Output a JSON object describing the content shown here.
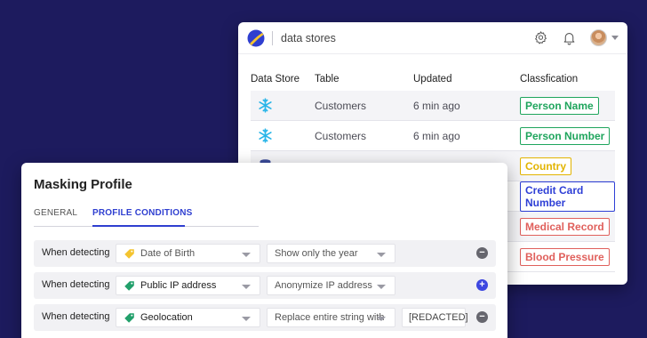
{
  "colors": {
    "background": "#1d1b5e",
    "accent_blue": "#2f3fd0",
    "snowflake": "#29b5e8",
    "tag_yellow": "#f4c430",
    "tag_green": "#22a06b"
  },
  "data_stores": {
    "title": "data stores",
    "icons": [
      "logo-icon",
      "settings-gear-icon",
      "bell-icon",
      "user-avatar",
      "caret-down-icon"
    ],
    "columns": [
      "Data Store",
      "Table",
      "Updated",
      "Classfication"
    ],
    "rows": [
      {
        "icon": "snowflake-icon",
        "table": "Customers",
        "updated": "6 min ago",
        "classification": "Person Name",
        "badge_color": "#1fa55d"
      },
      {
        "icon": "snowflake-icon",
        "table": "Customers",
        "updated": "6 min ago",
        "classification": "Person Number",
        "badge_color": "#1fa55d"
      },
      {
        "icon": "database-icon",
        "table": "",
        "updated": "",
        "classification": "Country",
        "badge_color": "#e2b400"
      },
      {
        "icon": "",
        "table": "",
        "updated": "",
        "classification": "Credit Card Number",
        "badge_color": "#2e3fd6"
      },
      {
        "icon": "",
        "table": "",
        "updated": "",
        "classification": "Medical Record",
        "badge_color": "#e0605c"
      },
      {
        "icon": "",
        "table": "",
        "updated": "",
        "classification": "Blood Pressure",
        "badge_color": "#e0605c"
      }
    ]
  },
  "masking_profile": {
    "title": "Masking Profile",
    "tabs": [
      {
        "label": "GENERAL",
        "active": false
      },
      {
        "label": "PROFILE CONDITIONS",
        "active": true
      }
    ],
    "conditions": [
      {
        "when": "When detecting",
        "field": "Date of Birth",
        "field_tag_color": "#f4c430",
        "action": "Show only the year",
        "replacement": "",
        "button": "minus"
      },
      {
        "when": "When detecting",
        "field": "Public IP address",
        "field_tag_color": "#22a06b",
        "action": "Anonymize IP address",
        "replacement": "",
        "button": "plus"
      },
      {
        "when": "When detecting",
        "field": "Geolocation",
        "field_tag_color": "#22a06b",
        "action": "Replace entire string with",
        "replacement": "[REDACTED]",
        "button": "minus"
      }
    ]
  }
}
